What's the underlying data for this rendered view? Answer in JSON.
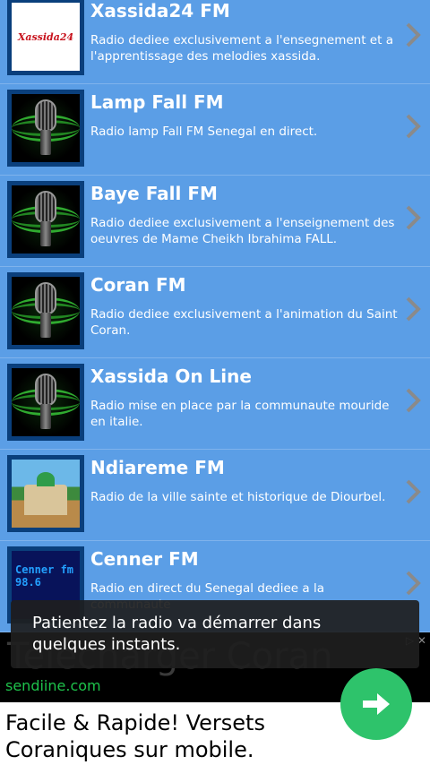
{
  "stations": [
    {
      "title": "Xassida24 FM",
      "desc": "Radio dediee exclusivement a l'ensegnement et a l'apprentissage des melodies xassida.",
      "thumb": "xassida",
      "logo_text": "Xassida24"
    },
    {
      "title": "Lamp Fall FM",
      "desc": "Radio lamp Fall FM Senegal en direct.",
      "thumb": "mic"
    },
    {
      "title": "Baye Fall FM",
      "desc": "Radio dediee exclusivement a l'enseignement des oeuvres de Mame Cheikh Ibrahima FALL.",
      "thumb": "mic"
    },
    {
      "title": "Coran FM",
      "desc": "Radio dediee exclusivement a l'animation du Saint Coran.",
      "thumb": "mic"
    },
    {
      "title": "Xassida On Line",
      "desc": "Radio mise en place par la communaute mouride en italie.",
      "thumb": "mic"
    },
    {
      "title": "Ndiareme FM",
      "desc": "Radio de la ville sainte et historique de Diourbel.",
      "thumb": "ndiareme"
    },
    {
      "title": "Cenner FM",
      "desc": "Radio en direct du Senegal dediee a la communaute",
      "thumb": "cenner",
      "logo_text": "Cenner fm 98.6"
    }
  ],
  "toast": {
    "message": "Patientez la radio va démarrer dans quelques instants."
  },
  "ad": {
    "headline": "Telecharger Coran",
    "domain": "sendiine.com",
    "body": "Facile & Rapide! Versets Coraniques sur mobile."
  },
  "colors": {
    "list_bg": "#5b9ee6",
    "ad_button": "#2ec36b",
    "ad_domain": "#1ec24b"
  }
}
